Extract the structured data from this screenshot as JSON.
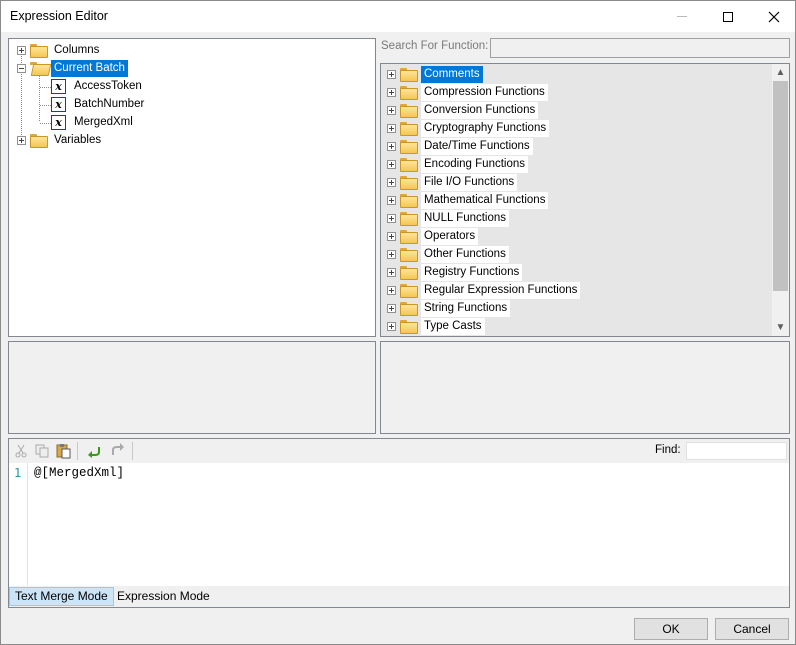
{
  "window": {
    "title": "Expression Editor"
  },
  "left_tree": {
    "items": [
      {
        "label": "Columns"
      },
      {
        "label": "Current Batch"
      },
      {
        "label": "AccessToken"
      },
      {
        "label": "BatchNumber"
      },
      {
        "label": "MergedXml"
      },
      {
        "label": "Variables"
      }
    ]
  },
  "search": {
    "label": "Search For Function:",
    "value": ""
  },
  "functions": {
    "items": [
      {
        "label": "Comments",
        "selected": true
      },
      {
        "label": "Compression Functions"
      },
      {
        "label": "Conversion Functions"
      },
      {
        "label": "Cryptography Functions"
      },
      {
        "label": "Date/Time Functions"
      },
      {
        "label": "Encoding Functions"
      },
      {
        "label": "File I/O Functions"
      },
      {
        "label": "Mathematical Functions"
      },
      {
        "label": "NULL Functions"
      },
      {
        "label": "Operators"
      },
      {
        "label": "Other Functions"
      },
      {
        "label": "Registry Functions"
      },
      {
        "label": "Regular Expression Functions"
      },
      {
        "label": "String Functions"
      },
      {
        "label": "Type Casts"
      }
    ]
  },
  "editor": {
    "find_label": "Find:",
    "find_value": "",
    "line_number": "1",
    "code": "@[MergedXml]",
    "modes": [
      {
        "label": "Text Merge Mode",
        "active": true
      },
      {
        "label": "Expression Mode",
        "active": false
      }
    ]
  },
  "buttons": {
    "ok": "OK",
    "cancel": "Cancel"
  }
}
